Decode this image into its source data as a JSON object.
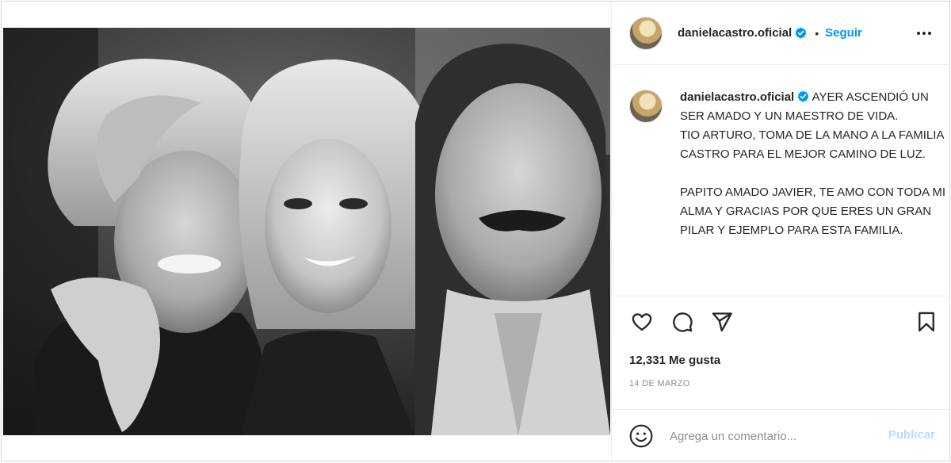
{
  "post": {
    "username": "danielacastro.oficial",
    "follow_label": "Seguir",
    "separator": "•",
    "caption": "AYER ASCENDIÓ UN SER AMADO Y UN MAESTRO DE VIDA.\nTIO ARTURO, TOMA DE LA MANO A LA FAMILIA CASTRO PARA EL MEJOR CAMINO DE LUZ.\n\nPAPITO AMADO JAVIER, TE AMO CON TODA MI ALMA Y GRACIAS POR QUE ERES UN GRAN PILAR Y EJEMPLO PARA ESTA FAMILIA.",
    "likes_text": "12,331 Me gusta",
    "date_text": "14 DE MARZO",
    "comment_placeholder": "Agrega un comentario...",
    "publish_label": "Publicar"
  },
  "icons": {
    "more": "more-options-icon",
    "verified": "verified-badge-icon",
    "like": "heart-icon",
    "comment": "comment-icon",
    "share": "paper-plane-icon",
    "save": "bookmark-icon",
    "emoji": "emoji-icon"
  },
  "colors": {
    "accent": "#0095f6",
    "publish_disabled": "#b2dffc",
    "text": "#262626",
    "muted": "#8e8e8e",
    "border": "#dbdbdb"
  }
}
